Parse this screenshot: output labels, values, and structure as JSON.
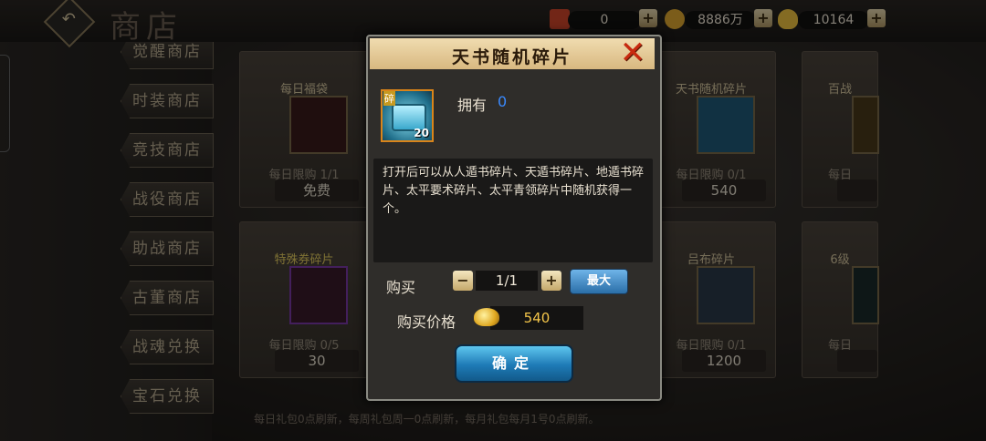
{
  "header": {
    "title": "商店",
    "back_icon": "↶",
    "resources": [
      {
        "name": "ticket",
        "value": "0",
        "color": "#d0452a"
      },
      {
        "name": "copper",
        "value": "8886万",
        "color": "#e0a830"
      },
      {
        "name": "gold",
        "value": "10164",
        "color": "#f0c440"
      }
    ],
    "plus": "+"
  },
  "nav": {
    "items": [
      "觉醒商店",
      "时装商店",
      "竞技商店",
      "战役商店",
      "助战商店",
      "古董商店",
      "战魂兑换",
      "宝石兑换"
    ]
  },
  "cards": [
    {
      "title": "每日福袋",
      "limit": "每日限购 1/1",
      "price": "免费"
    },
    {
      "title": "天书随机碎片",
      "limit": "每日限购 0/1",
      "price": "540"
    },
    {
      "title": "百战",
      "limit": "每日",
      "price": ""
    },
    {
      "title": "特殊券碎片",
      "limit": "每日限购 0/5",
      "price": "30"
    },
    {
      "title": "吕布碎片",
      "limit": "每日限购 0/1",
      "price": "1200"
    },
    {
      "title": "6级",
      "limit": "每日",
      "price": ""
    }
  ],
  "footer": "每日礼包0点刷新，每周礼包周一0点刷新，每月礼包每月1号0点刷新。",
  "modal": {
    "title": "天书随机碎片",
    "close_icon": "✕",
    "item": {
      "badge": "碎",
      "count": "20",
      "icon": "blue-chest-icon"
    },
    "own_label": "拥有",
    "own_value": "0",
    "description": "打开后可以从人遁书碎片、天遁书碎片、地遁书碎片、太平要术碎片、太平青领碎片中随机获得一个。",
    "buy_label": "购买",
    "minus": "−",
    "plus": "+",
    "quantity": "1/1",
    "max_label": "最大",
    "price_label": "购买价格",
    "price_value": "540",
    "confirm_label": "确定"
  }
}
